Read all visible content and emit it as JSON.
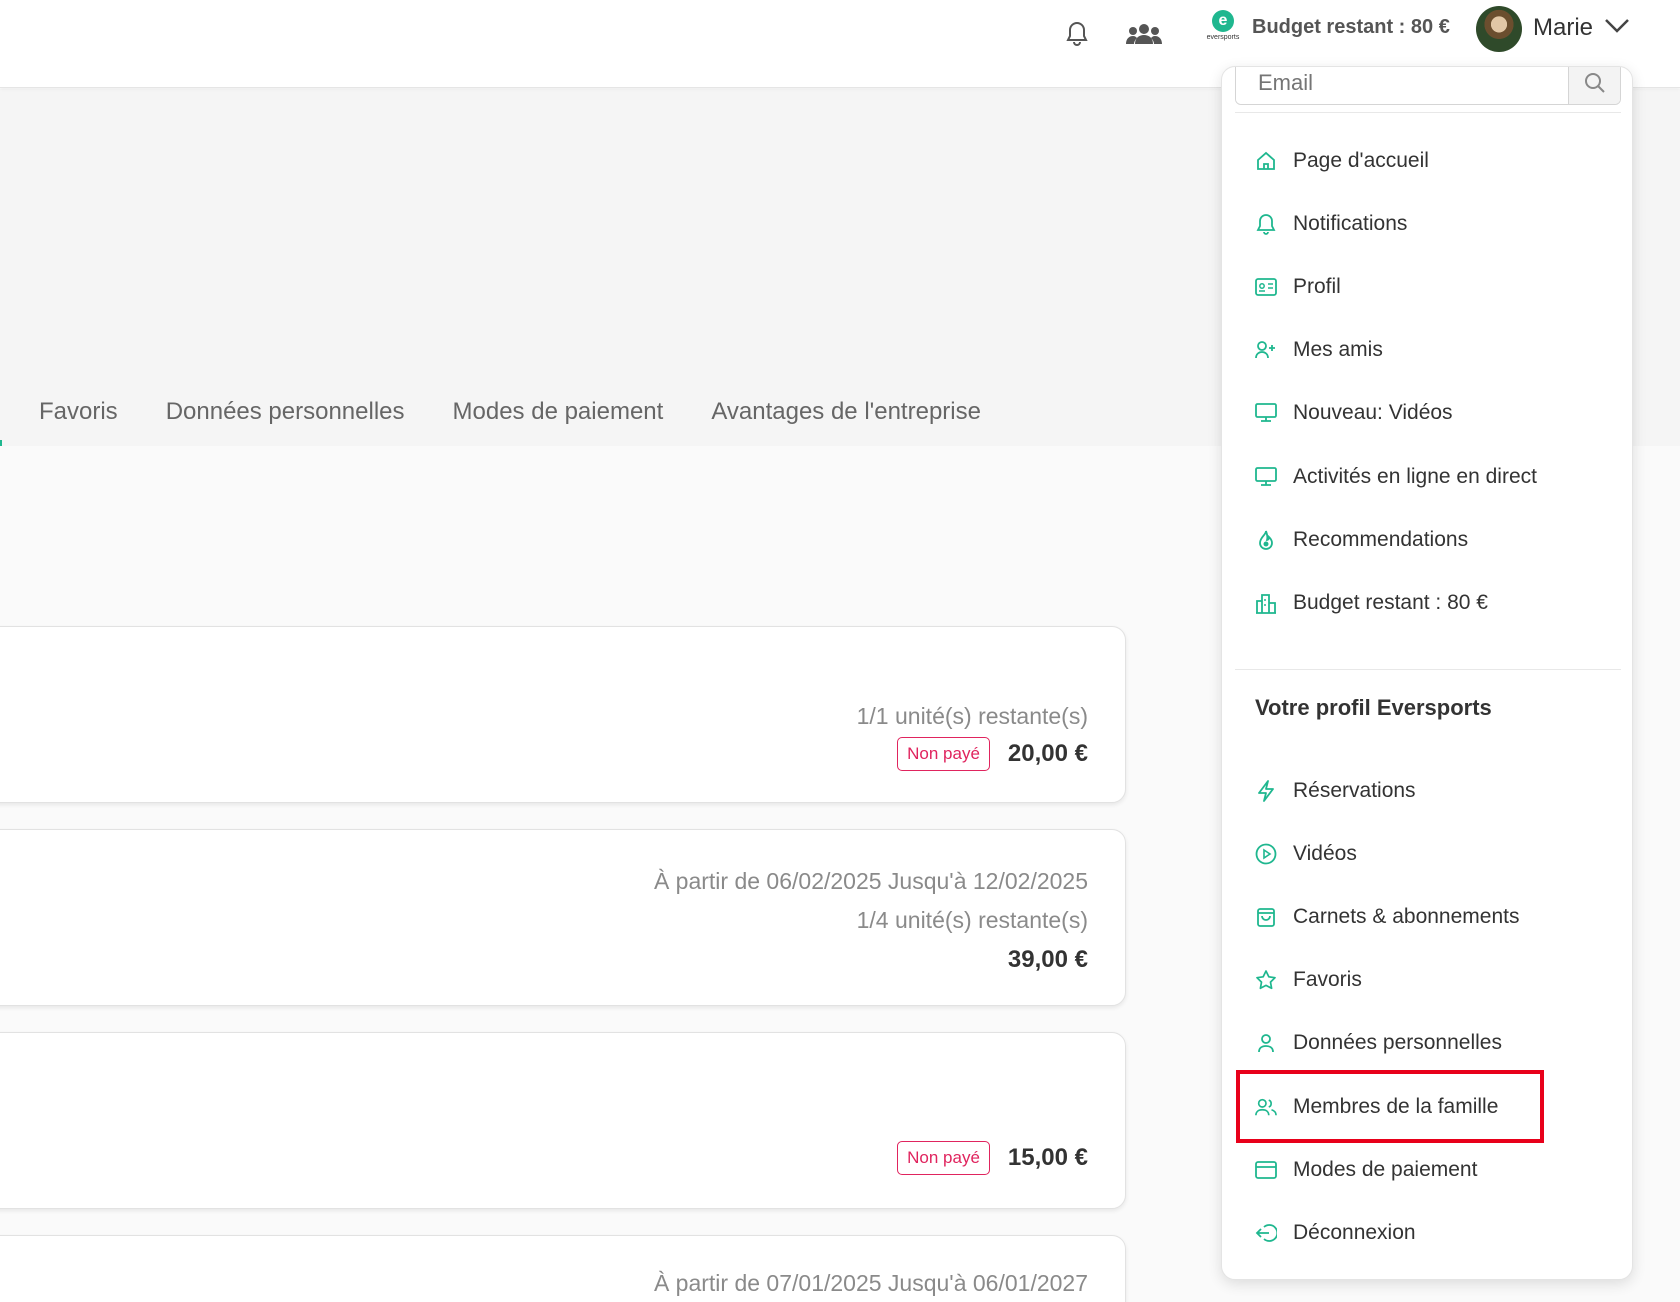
{
  "header": {
    "budget": "Budget restant : 80 €",
    "brand_wordmark": "eversports",
    "user_name": "Marie",
    "icons": [
      "bell-icon",
      "group-icon",
      "eversports-logo",
      "chevron-down-icon"
    ]
  },
  "tabs": [
    "Favoris",
    "Données personnelles",
    "Modes de paiement",
    "Avantages de l'entreprise"
  ],
  "cards": [
    {
      "units": "1/1 unité(s) restante(s)",
      "badge": "Non payé",
      "price": "20,00 €"
    },
    {
      "period": "À partir de 06/02/2025 Jusqu'à 12/02/2025",
      "units": "1/4 unité(s) restante(s)",
      "price": "39,00 €"
    },
    {
      "badge": "Non payé",
      "price": "15,00 €"
    },
    {
      "period": "À partir de 07/01/2025 Jusqu'à 06/01/2027"
    }
  ],
  "menu": {
    "search_placeholder": "Email",
    "items": [
      {
        "label": "Page d'accueil",
        "icon": "home-icon"
      },
      {
        "label": "Notifications",
        "icon": "bell-icon"
      },
      {
        "label": "Profil",
        "icon": "id-card-icon"
      },
      {
        "label": "Mes amis",
        "icon": "add-friend-icon"
      },
      {
        "label": "Nouveau: Vidéos",
        "icon": "monitor-icon"
      },
      {
        "label": "Activités en ligne en direct",
        "icon": "monitor-icon"
      },
      {
        "label": "Recommendations",
        "icon": "flame-icon"
      },
      {
        "label": "Budget restant : 80 €",
        "icon": "buildings-icon"
      }
    ],
    "section_title": "Votre profil Eversports",
    "profile_items": [
      {
        "label": "Réservations",
        "icon": "lightning-icon"
      },
      {
        "label": "Vidéos",
        "icon": "play-circle-icon"
      },
      {
        "label": "Carnets & abonnements",
        "icon": "shopping-bag-icon"
      },
      {
        "label": "Favoris",
        "icon": "star-icon"
      },
      {
        "label": "Données personnelles",
        "icon": "person-icon"
      },
      {
        "label": "Membres de la famille",
        "icon": "family-icon"
      },
      {
        "label": "Modes de paiement",
        "icon": "credit-card-icon"
      },
      {
        "label": "Déconnexion",
        "icon": "logout-icon"
      }
    ]
  },
  "colors": {
    "accent": "#1fb78f",
    "unpaid": "#e0245e",
    "highlight": "#e8001a"
  }
}
